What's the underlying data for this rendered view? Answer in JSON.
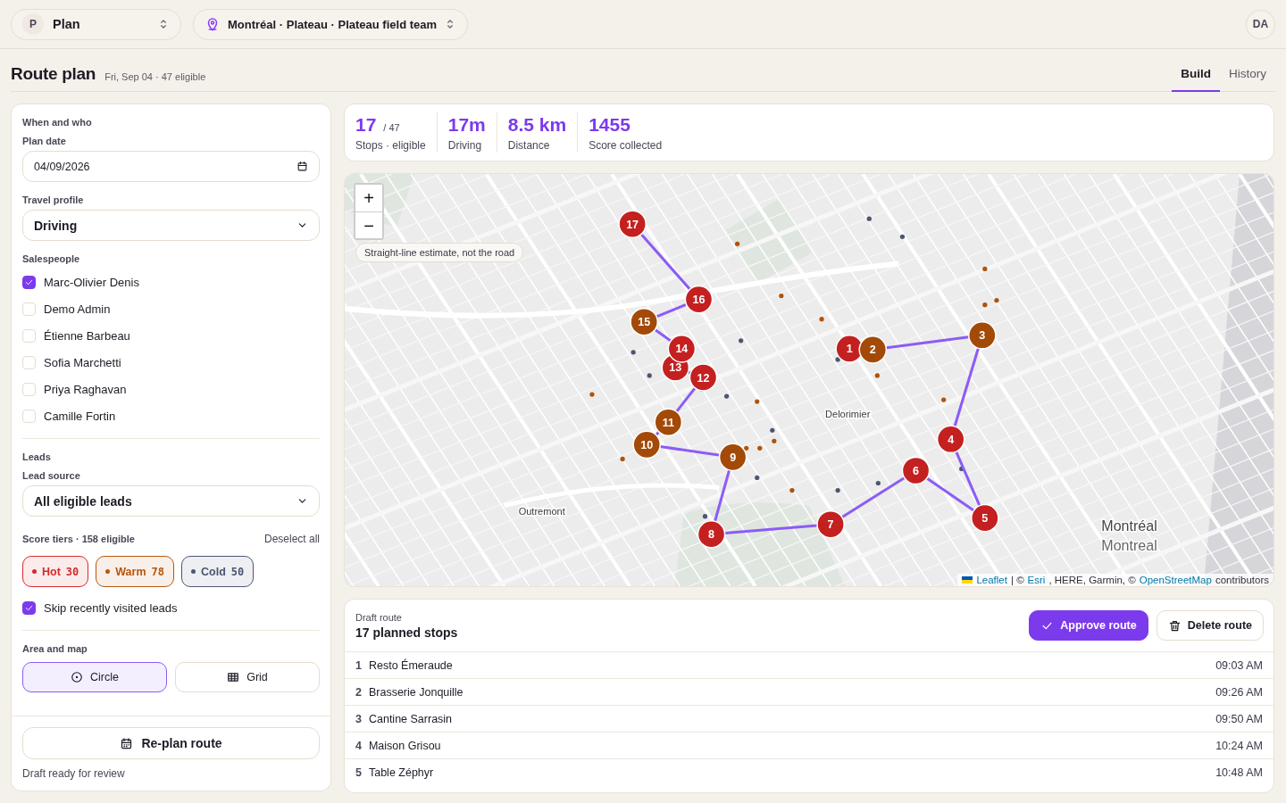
{
  "top_bar": {
    "workspace": {
      "initial": "P",
      "label": "Plan"
    },
    "location": "Montréal · Plateau · Plateau field team",
    "user_initials": "DA"
  },
  "page": {
    "title": "Route plan",
    "subtitle": "Fri, Sep 04 · 47 eligible",
    "tabs": [
      {
        "label": "Build",
        "selected": true
      },
      {
        "label": "History",
        "selected": false
      }
    ]
  },
  "sidebar": {
    "section_when": "When and who",
    "plan_date": {
      "label": "Plan date",
      "value": "04/09/2026"
    },
    "travel_profile": {
      "label": "Travel profile",
      "value": "Driving"
    },
    "salespeople_label": "Salespeople",
    "salespeople": [
      {
        "name": "Marc-Olivier Denis",
        "checked": true
      },
      {
        "name": "Demo Admin",
        "checked": false
      },
      {
        "name": "Étienne Barbeau",
        "checked": false
      },
      {
        "name": "Sofia Marchetti",
        "checked": false
      },
      {
        "name": "Priya Raghavan",
        "checked": false
      },
      {
        "name": "Camille Fortin",
        "checked": false
      }
    ],
    "leads_section": "Leads",
    "lead_source": {
      "label": "Lead source",
      "value": "All eligible leads"
    },
    "score_tiers": {
      "label": "Score tiers · 158 eligible",
      "action": "Deselect all",
      "tiers": [
        {
          "name": "Hot",
          "count": "30",
          "color": "#d42a2a",
          "selected": true
        },
        {
          "name": "Warm",
          "count": "78",
          "color": "#b5570d",
          "selected": true
        },
        {
          "name": "Cold",
          "count": "50",
          "color": "#4b5670",
          "selected": true
        }
      ]
    },
    "skip_recent": {
      "label": "Skip recently visited leads",
      "checked": true
    },
    "area_section": "Area and map",
    "area_modes": [
      {
        "label": "Circle",
        "kind": "circle",
        "selected": true
      },
      {
        "label": "Grid",
        "kind": "grid",
        "selected": false
      }
    ],
    "replan_button": "Re-plan route",
    "status": "Draft ready for review"
  },
  "stats": [
    {
      "value": "17",
      "suffix": "/ 47",
      "label": "Stops · eligible"
    },
    {
      "value": "17m",
      "label": "Driving"
    },
    {
      "value": "8.5 km",
      "label": "Distance"
    },
    {
      "value": "1455",
      "label": "Score collected"
    }
  ],
  "map": {
    "zoom_controls": [
      "+",
      "−"
    ],
    "note": "Straight-line estimate, not the road",
    "places": [
      {
        "name": "Delorimier",
        "kind": "district"
      },
      {
        "name": "Outremont",
        "kind": "district"
      },
      {
        "name": "Montréal",
        "kind": "city"
      },
      {
        "name": "Montreal",
        "kind": "city-alt"
      }
    ],
    "markers": [
      {
        "label": "1",
        "color": "#c42020"
      },
      {
        "label": "2",
        "color": "#a34a08"
      },
      {
        "label": "3",
        "color": "#a34a08"
      },
      {
        "label": "4",
        "color": "#c42020"
      },
      {
        "label": "5",
        "color": "#c42020"
      },
      {
        "label": "6",
        "color": "#c42020"
      },
      {
        "label": "7",
        "color": "#c42020"
      },
      {
        "label": "8",
        "color": "#c42020"
      },
      {
        "label": "9",
        "color": "#a34a08"
      },
      {
        "label": "10",
        "color": "#a34a08"
      },
      {
        "label": "11",
        "color": "#a34a08"
      },
      {
        "label": "12",
        "color": "#c42020"
      },
      {
        "label": "13",
        "color": "#c42020"
      },
      {
        "label": "14",
        "color": "#c42020"
      },
      {
        "label": "15",
        "color": "#a34a08"
      },
      {
        "label": "16",
        "color": "#c42020"
      },
      {
        "label": "17",
        "color": "#c42020"
      }
    ],
    "attribution": [
      {
        "text": "Leaflet",
        "link": true
      },
      {
        "text": "| ©",
        "link": false
      },
      {
        "text": "Esri",
        "link": true
      },
      {
        "text": ", HERE, Garmin, ©",
        "link": false
      },
      {
        "text": "OpenStreetMap",
        "link": true
      },
      {
        "text": "contributors",
        "link": false
      }
    ]
  },
  "draft_route": {
    "caption": "Draft route",
    "title": "17 planned stops",
    "approve_button": "Approve route",
    "delete_button": "Delete route",
    "stops": [
      {
        "number": "1",
        "name": "Resto Émeraude",
        "time": "09:03 AM"
      },
      {
        "number": "2",
        "name": "Brasserie Jonquille",
        "time": "09:26 AM"
      },
      {
        "number": "3",
        "name": "Cantine Sarrasin",
        "time": "09:50 AM"
      },
      {
        "number": "4",
        "name": "Maison Grisou",
        "time": "10:24 AM"
      },
      {
        "number": "5",
        "name": "Table Zéphyr",
        "time": "10:48 AM"
      }
    ]
  }
}
